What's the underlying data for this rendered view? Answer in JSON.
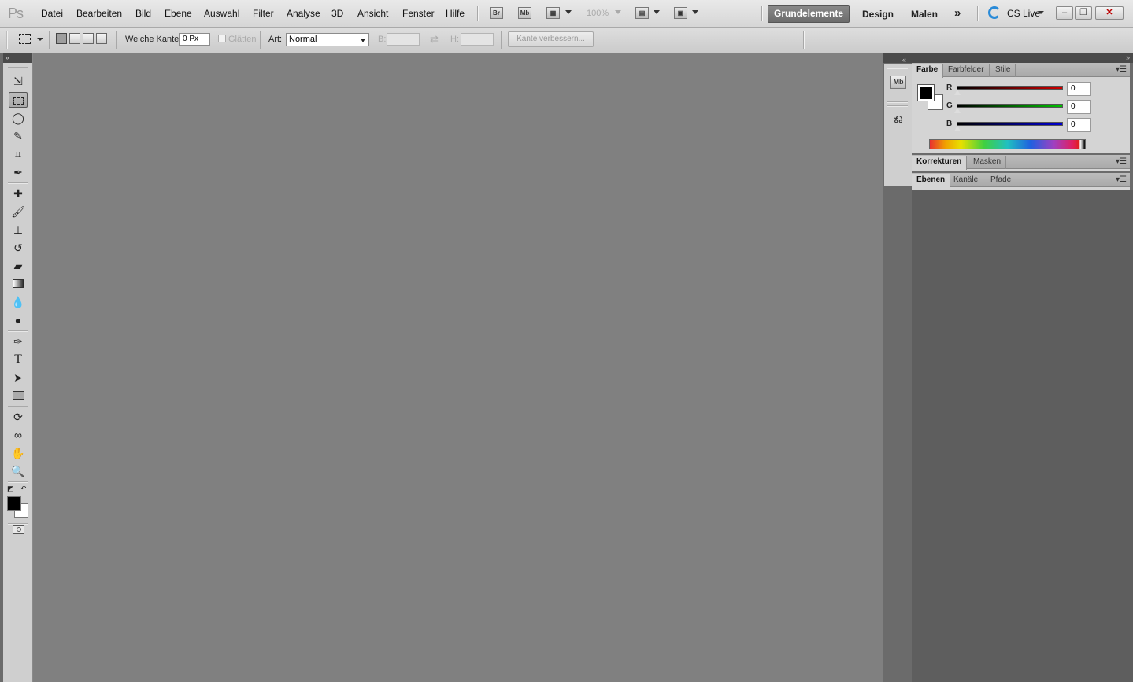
{
  "app": {
    "logo": "Ps"
  },
  "menu": [
    "Datei",
    "Bearbeiten",
    "Bild",
    "Ebene",
    "Auswahl",
    "Filter",
    "Analyse",
    "3D",
    "Ansicht",
    "Fenster",
    "Hilfe"
  ],
  "appbar": {
    "bridge_label": "Br",
    "minibridge_label": "Mb",
    "zoom": "100%",
    "workspaces": {
      "active": "Grundelemente",
      "design": "Design",
      "paint": "Malen",
      "more": "»"
    },
    "cs_live": "CS Live"
  },
  "window_controls": {
    "minimize": "–",
    "restore": "❐",
    "close": "✕"
  },
  "options": {
    "feather_label": "Weiche Kante:",
    "feather_value": "0 Px",
    "antialias_label": "Glätten",
    "style_label": "Art:",
    "style_value": "Normal",
    "width_label": "B:",
    "height_label": "H:",
    "swap_icon": "⇄",
    "refine_edge": "Kante verbessern..."
  },
  "panels": {
    "color_tabs": [
      "Farbe",
      "Farbfelder",
      "Stile"
    ],
    "adjust_tabs": [
      "Korrekturen",
      "Masken"
    ],
    "layer_tabs": [
      "Ebenen",
      "Kanäle",
      "Pfade"
    ],
    "color": {
      "r_label": "R",
      "r_value": "0",
      "g_label": "G",
      "g_value": "0",
      "b_label": "B",
      "b_value": "0",
      "r_color": "#d00000",
      "g_color": "#00c000",
      "b_color": "#0000d0"
    }
  },
  "dock": {
    "minibridge": "Mb"
  },
  "icons": {
    "collapse": "»",
    "expand": "«",
    "panel_menu": "▾☰"
  }
}
